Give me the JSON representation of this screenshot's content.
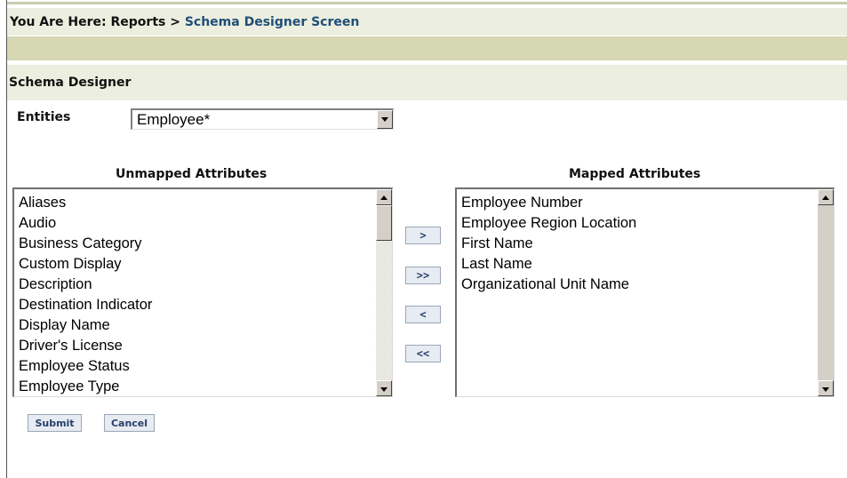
{
  "breadcrumb": {
    "prefix": "You Are Here: Reports > ",
    "current": "Schema Designer Screen"
  },
  "section": {
    "title": "Schema Designer"
  },
  "entities": {
    "label": "Entities",
    "selected": "Employee*"
  },
  "unmapped": {
    "heading": "Unmapped Attributes",
    "items": [
      "Aliases",
      "Audio",
      "Business Category",
      "Custom Display",
      "Description",
      "Destination Indicator",
      "Display Name",
      "Driver's License",
      "Employee Status",
      "Employee Type"
    ]
  },
  "mapped": {
    "heading": "Mapped Attributes",
    "items": [
      "Employee Number",
      "Employee Region Location",
      "First Name",
      "Last Name",
      "Organizational Unit Name"
    ]
  },
  "move_buttons": {
    "add": ">",
    "add_all": ">>",
    "remove": "<",
    "remove_all": "<<"
  },
  "actions": {
    "submit": "Submit",
    "cancel": "Cancel"
  },
  "colors": {
    "header_bg": "#eceedf",
    "olive_bar": "#d6d7b3",
    "link_blue": "#1f4e79",
    "button_text": "#27406b"
  }
}
